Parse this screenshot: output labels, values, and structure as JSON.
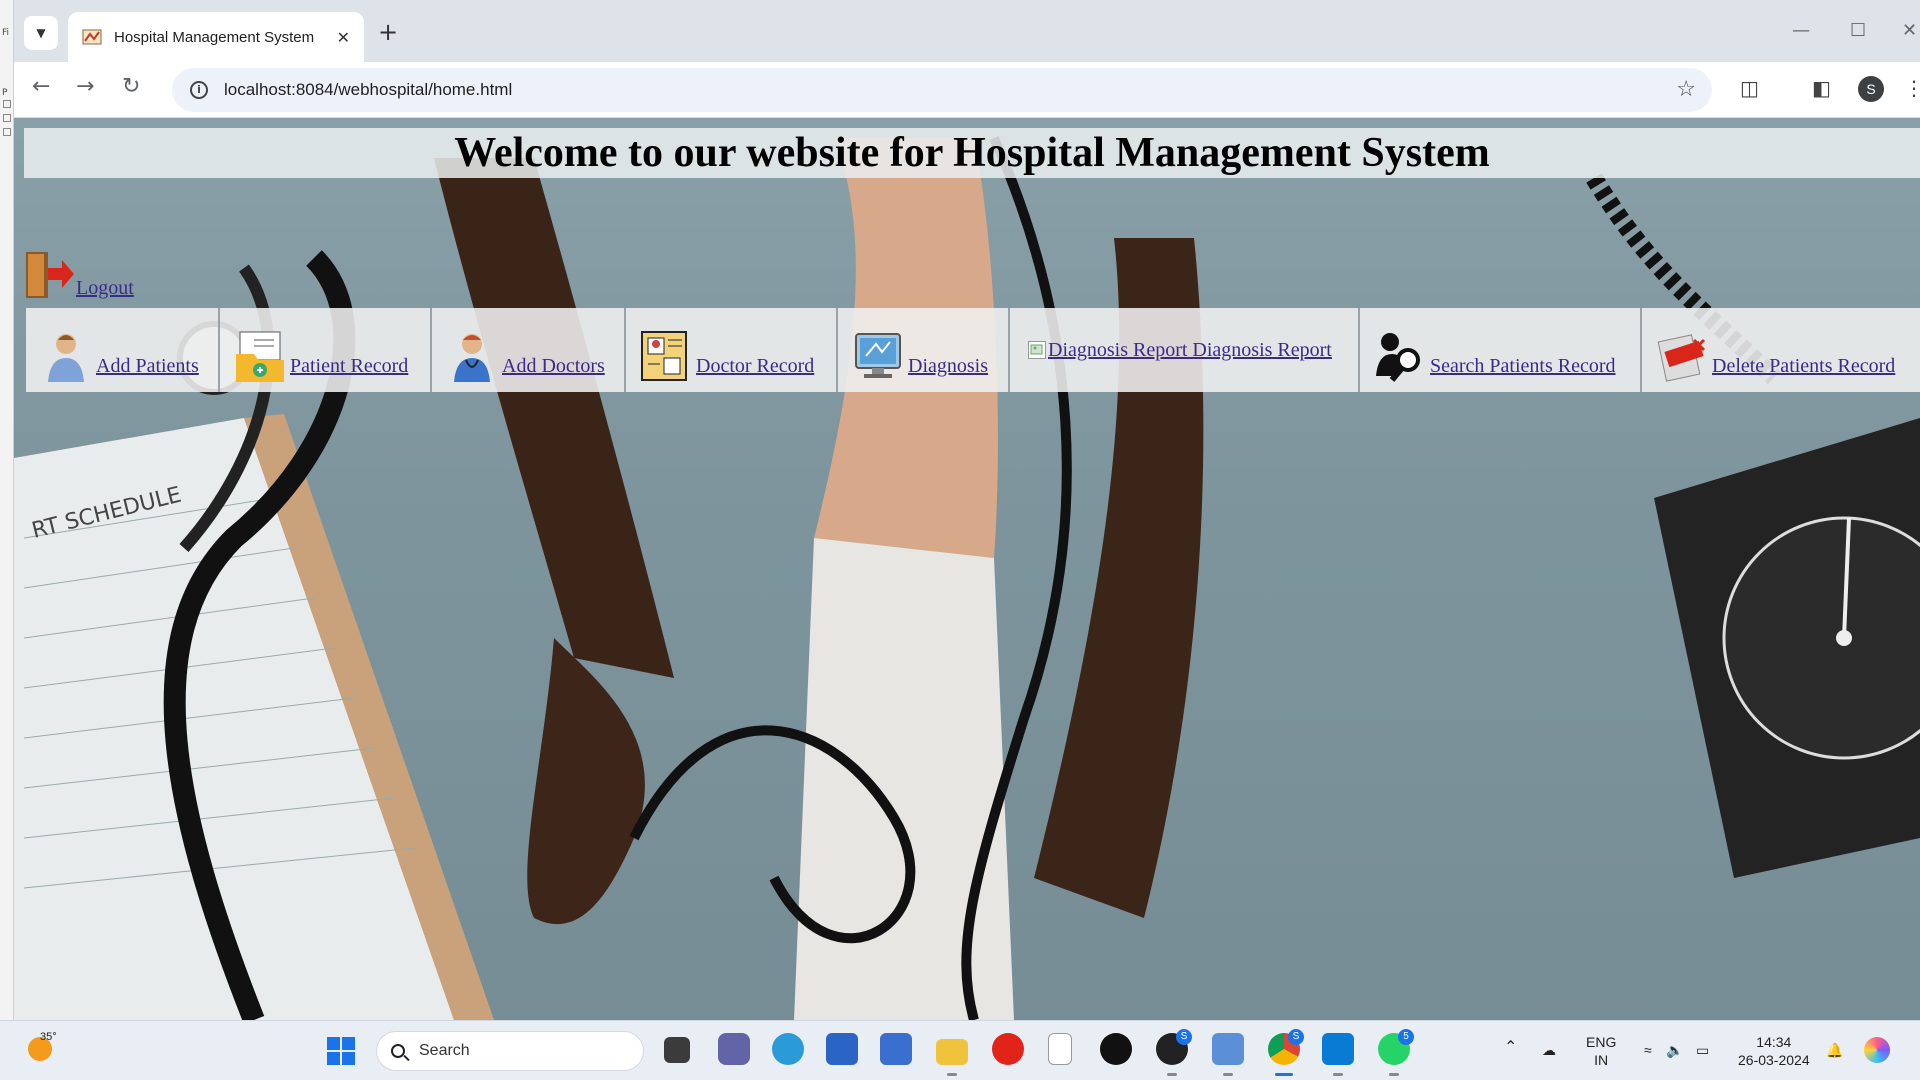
{
  "browser": {
    "tab_title": "Hospital Management System",
    "url": "localhost:8084/webhospital/home.html",
    "profile_initial": "S",
    "new_tab_symbol": "+",
    "left_strip_letters": [
      "P",
      "Fi"
    ]
  },
  "page": {
    "welcome": "Welcome to our website for Hospital Management System",
    "logout_label": "Logout",
    "menu": [
      {
        "label": "Add Patients",
        "icon": "patient-icon"
      },
      {
        "label": "Patient Record",
        "icon": "record-folder-icon"
      },
      {
        "label": "Add Doctors",
        "icon": "doctor-icon"
      },
      {
        "label": "Doctor Record",
        "icon": "doctor-record-icon"
      },
      {
        "label": "Diagnosis",
        "icon": "monitor-icon"
      },
      {
        "label": "Diagnosis Report Diagnosis Report",
        "alt": "Diagnosis Report",
        "icon": "broken-image-icon"
      },
      {
        "label": "Search Patients Record",
        "icon": "search-person-icon"
      },
      {
        "label": "Delete Patients Record",
        "icon": "delete-icon"
      }
    ]
  },
  "taskbar": {
    "weather_temp": "35°",
    "search_label": "Search",
    "lang_line1": "ENG",
    "lang_line2": "IN",
    "time": "14:34",
    "date": "26-03-2024",
    "chrome_badge": "S",
    "steam_badge": "S",
    "whatsapp_badge": "5"
  },
  "colors": {
    "link": "#3a2a8a",
    "accent": "#1a73e8"
  }
}
